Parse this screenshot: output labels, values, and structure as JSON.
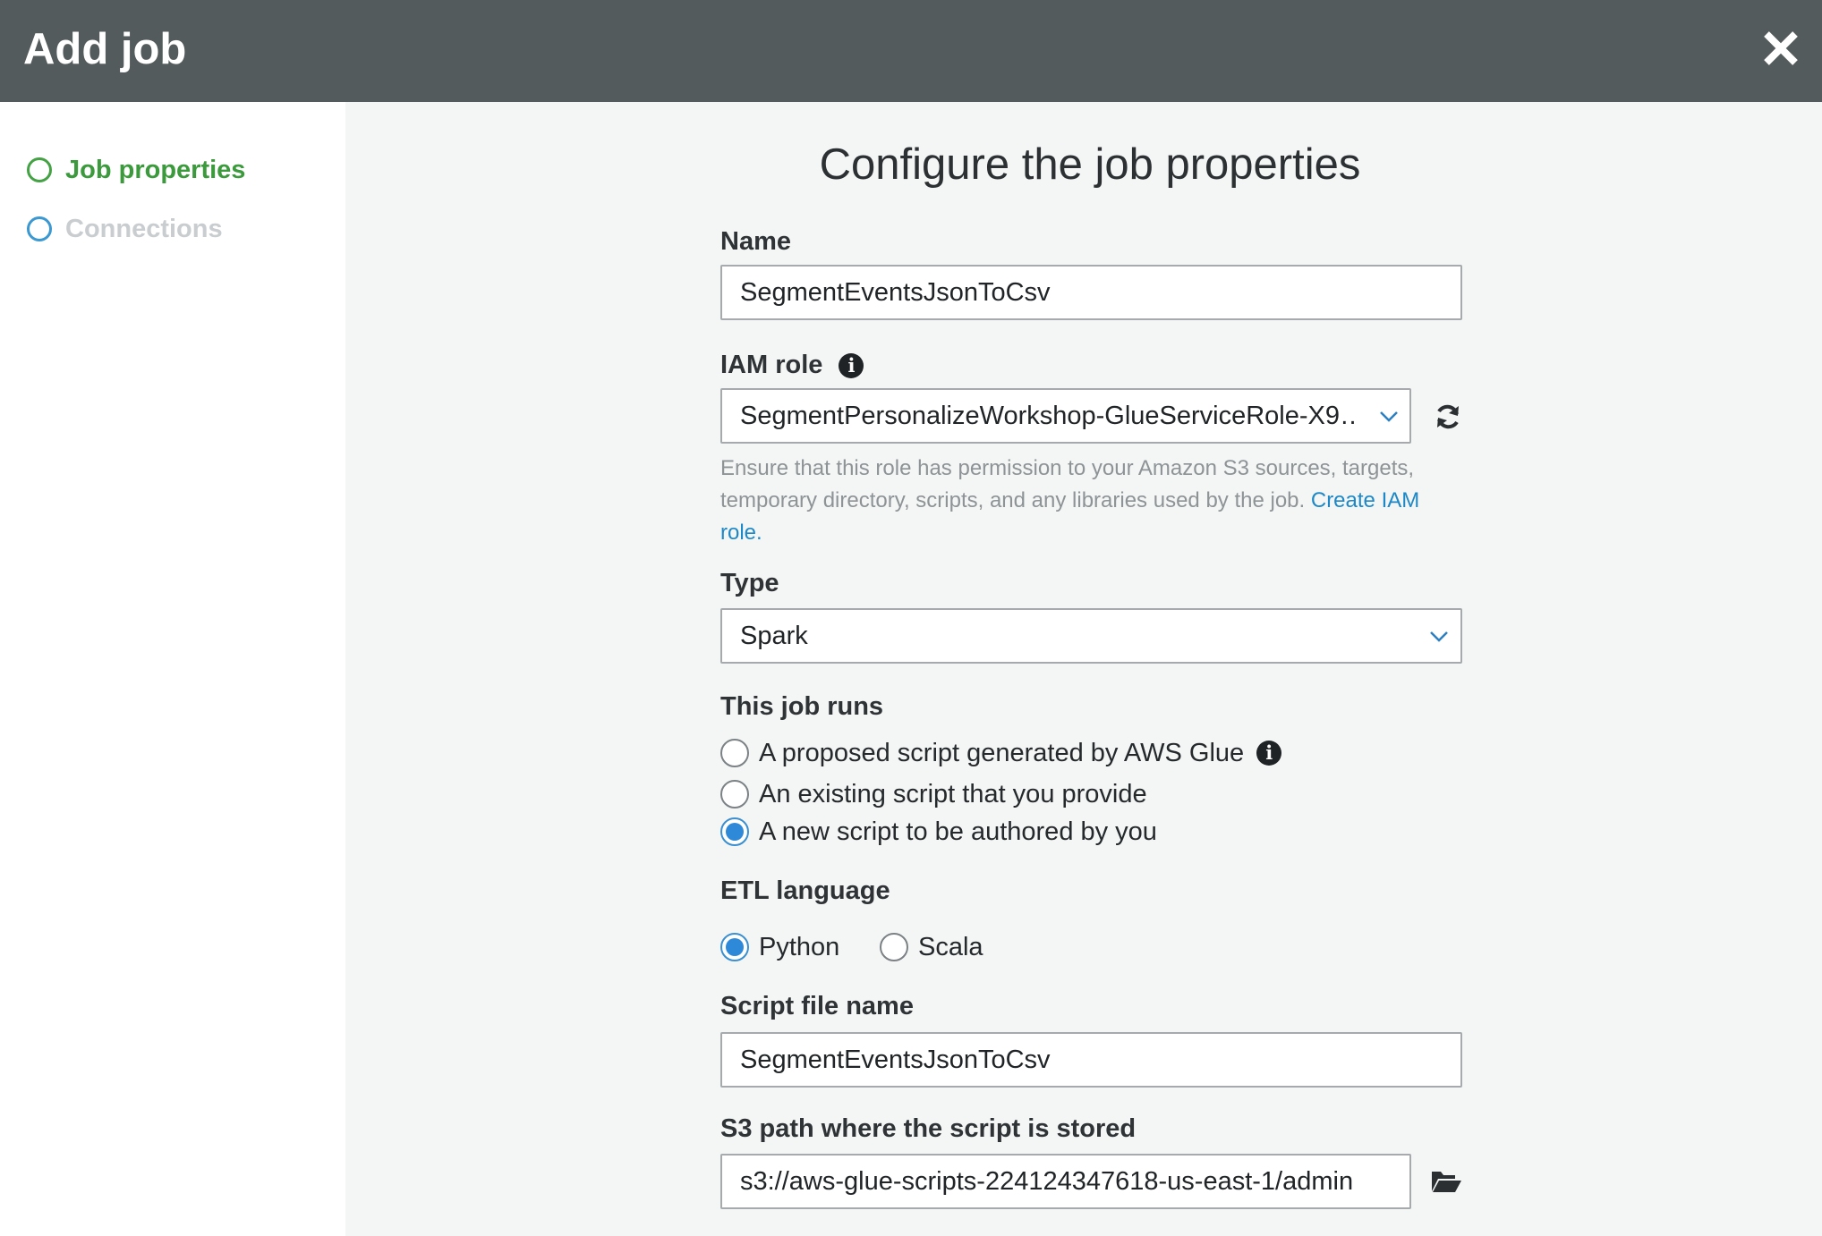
{
  "header": {
    "title": "Add job",
    "close_icon": "close-icon"
  },
  "sidebar": {
    "steps": [
      {
        "label": "Job properties",
        "state": "active"
      },
      {
        "label": "Connections",
        "state": "inactive"
      }
    ]
  },
  "main": {
    "heading": "Configure the job properties",
    "name": {
      "label": "Name",
      "value": "SegmentEventsJsonToCsv"
    },
    "iam_role": {
      "label": "IAM role",
      "value": "SegmentPersonalizeWorkshop-GlueServiceRole-X9…",
      "help_text": "Ensure that this role has permission to your Amazon S3 sources, targets, temporary directory, scripts, and any libraries used by the job.",
      "help_link": "Create IAM role."
    },
    "type": {
      "label": "Type",
      "value": "Spark"
    },
    "job_runs": {
      "label": "This job runs",
      "options": [
        {
          "label": "A proposed script generated by AWS Glue",
          "checked": false
        },
        {
          "label": "An existing script that you provide",
          "checked": false
        },
        {
          "label": "A new script to be authored by you",
          "checked": true
        }
      ]
    },
    "etl_language": {
      "label": "ETL language",
      "options": [
        {
          "label": "Python",
          "checked": true
        },
        {
          "label": "Scala",
          "checked": false
        }
      ]
    },
    "script_file_name": {
      "label": "Script file name",
      "value": "SegmentEventsJsonToCsv"
    },
    "s3_path": {
      "label": "S3 path where the script is stored",
      "value": "s3://aws-glue-scripts-224124347618-us-east-1/admin"
    }
  },
  "colors": {
    "header_bg": "#545b5c",
    "active_step": "#3b9a3b",
    "link": "#1e88c6",
    "radio_selected": "#2e8ad8"
  }
}
